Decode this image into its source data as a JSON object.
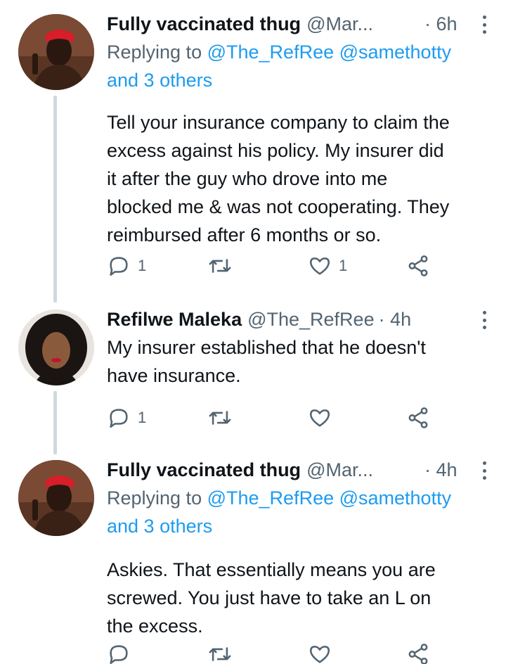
{
  "tweets": [
    {
      "name": "Fully vaccinated thug",
      "handle": "@Mar...",
      "time": "· 6h",
      "reply_prefix": "Replying to",
      "reply_mentions": "@The_RefRee @samethotty",
      "reply_others": "and 3 others",
      "text_lines": [
        "Tell your insurance company to claim the",
        "excess against his policy. My insurer did",
        "it after the guy who drove into me",
        "blocked me & was not cooperating. They",
        "reimbursed after 6 months or so."
      ],
      "reply_count": "1",
      "retweet_count": "",
      "like_count": "1"
    },
    {
      "name": "Refilwe Maleka",
      "handle": "@The_RefRee",
      "time": "· 4h",
      "text_lines": [
        "My insurer established that he doesn't",
        "have insurance."
      ],
      "reply_count": "1",
      "retweet_count": "",
      "like_count": ""
    },
    {
      "name": "Fully vaccinated thug",
      "handle": "@Mar...",
      "time": "· 4h",
      "reply_prefix": "Replying to",
      "reply_mentions": "@The_RefRee @samethotty",
      "reply_others": "and 3 others",
      "text_lines": [
        "Askies. That essentially means you are",
        "screwed. You just have to take an L on",
        "the excess."
      ],
      "reply_count": "",
      "retweet_count": "",
      "like_count": ""
    }
  ],
  "icons": {
    "reply": "reply-icon",
    "retweet": "retweet-icon",
    "like": "heart-icon",
    "share": "share-icon",
    "more": "more-icon"
  },
  "colors": {
    "text": "#0f1419",
    "secondary": "#536471",
    "link": "#1d9bf0",
    "thread_line": "#cfd9de"
  }
}
